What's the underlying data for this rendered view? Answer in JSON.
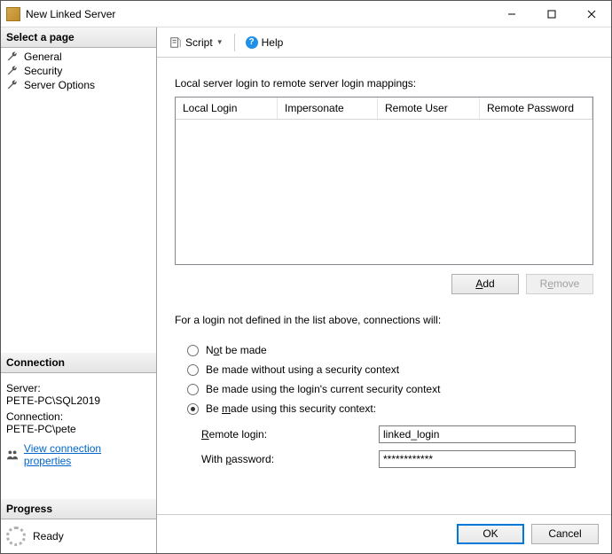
{
  "window": {
    "title": "New Linked Server"
  },
  "sidebar": {
    "select_page_header": "Select a page",
    "pages": [
      {
        "label": "General"
      },
      {
        "label": "Security"
      },
      {
        "label": "Server Options"
      }
    ],
    "connection_header": "Connection",
    "server_label": "Server:",
    "server_value": "PETE-PC\\SQL2019",
    "connection_label": "Connection:",
    "connection_value": "PETE-PC\\pete",
    "view_conn_props": "View connection properties",
    "progress_header": "Progress",
    "progress_status": "Ready"
  },
  "toolbar": {
    "script_label": "Script",
    "help_label": "Help"
  },
  "content": {
    "mappings_label": "Local server login to remote server login mappings:",
    "columns": {
      "c1": "Local Login",
      "c2": "Impersonate",
      "c3": "Remote User",
      "c4": "Remote Password"
    },
    "add_label": "Add",
    "remove_label": "Remove",
    "explain": "For a login not defined in the list above, connections will:",
    "radios": {
      "r1": "Not be made",
      "r2": "Be made without using a security context",
      "r3": "Be made using the login's current security context",
      "r4": "Be made using this security context:"
    },
    "remote_login_label": "Remote login:",
    "remote_login_value": "linked_login",
    "with_password_label": "With password:",
    "with_password_value": "************"
  },
  "footer": {
    "ok": "OK",
    "cancel": "Cancel"
  }
}
